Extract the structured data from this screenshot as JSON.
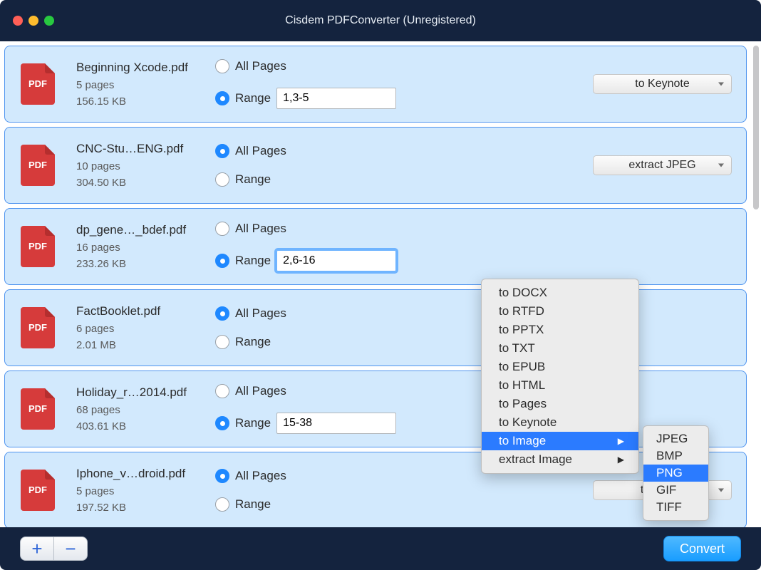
{
  "window_title": "Cisdem PDFConverter (Unregistered)",
  "radio_labels": {
    "all": "All Pages",
    "range": "Range"
  },
  "files": [
    {
      "name": "Beginning Xcode.pdf",
      "pages": "5 pages",
      "size": "156.15 KB",
      "selected": "range",
      "range": "1,3-5",
      "format": "to Keynote"
    },
    {
      "name": "CNC-Stu…ENG.pdf",
      "pages": "10 pages",
      "size": "304.50 KB",
      "selected": "all",
      "range": "",
      "format": "extract JPEG"
    },
    {
      "name": "dp_gene…_bdef.pdf",
      "pages": "16 pages",
      "size": "233.26 KB",
      "selected": "range",
      "range": "2,6-16",
      "format": "",
      "focused": true
    },
    {
      "name": "FactBooklet.pdf",
      "pages": "6 pages",
      "size": "2.01 MB",
      "selected": "all",
      "range": "",
      "format": ""
    },
    {
      "name": "Holiday_r…2014.pdf",
      "pages": "68 pages",
      "size": "403.61 KB",
      "selected": "range",
      "range": "15-38",
      "format": ""
    },
    {
      "name": "Iphone_v…droid.pdf",
      "pages": "5 pages",
      "size": "197.52 KB",
      "selected": "all",
      "range": "",
      "format": "to EPUB"
    }
  ],
  "dropdown_items": [
    {
      "label": "to DOCX"
    },
    {
      "label": "to RTFD"
    },
    {
      "label": "to PPTX"
    },
    {
      "label": "to TXT"
    },
    {
      "label": "to EPUB"
    },
    {
      "label": "to HTML"
    },
    {
      "label": "to Pages"
    },
    {
      "label": "to Keynote"
    },
    {
      "label": "to Image",
      "submenu": true,
      "highlighted": true
    },
    {
      "label": "extract Image",
      "submenu": true
    }
  ],
  "submenu_items": [
    {
      "label": "JPEG"
    },
    {
      "label": "BMP"
    },
    {
      "label": "PNG",
      "highlighted": true
    },
    {
      "label": "GIF"
    },
    {
      "label": "TIFF"
    }
  ],
  "footer": {
    "add": "+",
    "remove": "−",
    "convert": "Convert"
  },
  "pdf_badge": "PDF"
}
